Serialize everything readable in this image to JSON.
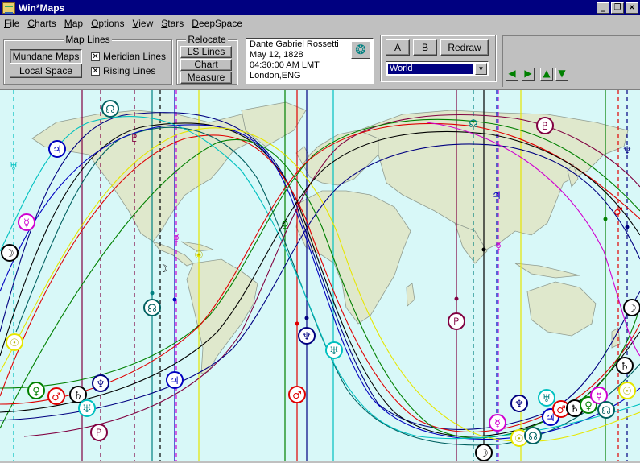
{
  "window": {
    "title": "Win*Maps",
    "min_label": "_",
    "restore_label": "❐",
    "close_label": "×"
  },
  "menu": [
    {
      "label": "File",
      "key": "F",
      "rest": "ile"
    },
    {
      "label": "Charts",
      "key": "C",
      "rest": "harts"
    },
    {
      "label": "Map",
      "key": "M",
      "rest": "ap"
    },
    {
      "label": "Options",
      "key": "O",
      "rest": "ptions"
    },
    {
      "label": "View",
      "key": "V",
      "rest": "iew"
    },
    {
      "label": "Stars",
      "key": "S",
      "rest": "tars"
    },
    {
      "label": "DeepSpace",
      "key": "D",
      "rest": "eepSpace"
    }
  ],
  "map_lines": {
    "title": "Map Lines",
    "mundane_label": "Mundane Maps",
    "local_label": "Local Space",
    "meridian_label": "Meridian Lines",
    "rising_label": "Rising Lines",
    "meridian_checked": "✕",
    "rising_checked": "✕"
  },
  "relocate": {
    "title": "Relocate",
    "ls_lines_label": "LS  Lines",
    "chart_label": "Chart",
    "measure_label": "Measure"
  },
  "chart_info": {
    "name": "Dante Gabriel Rossetti",
    "date": "May 12, 1828",
    "time": "04:30:00 AM LMT",
    "place": "London,ENG",
    "wheel_icon": "❂"
  },
  "chart_buttons": {
    "a_label": "A",
    "b_label": "B",
    "redraw_label": "Redraw"
  },
  "region_select": {
    "value": "World"
  },
  "nav": {
    "left": "◀",
    "right": "▶",
    "up": "▲",
    "down": "▼"
  },
  "colors": {
    "ocean": "#d8f8f8",
    "land": "#dfe8cc",
    "border": "#909c90",
    "sun": "#e6e600",
    "moon": "#000000",
    "mercury": "#d000d0",
    "venus": "#008000",
    "mars": "#e00000",
    "jupiter": "#0000c0",
    "saturn": "#000000",
    "uranus": "#00c0c0",
    "neptune": "#000080",
    "pluto": "#800040",
    "node": "#006060"
  },
  "planet_markers": [
    {
      "glyph": "☊",
      "color": "#006060"
    },
    {
      "glyph": "♃",
      "color": "#0000c0"
    },
    {
      "glyph": "☿",
      "color": "#d000d0"
    },
    {
      "glyph": "☽",
      "color": "#000000"
    },
    {
      "glyph": "☉",
      "color": "#e6e600"
    },
    {
      "glyph": "♀",
      "color": "#008000"
    },
    {
      "glyph": "♂",
      "color": "#e00000"
    },
    {
      "glyph": "♄",
      "color": "#000000"
    },
    {
      "glyph": "♅",
      "color": "#00c0c0"
    },
    {
      "glyph": "♆",
      "color": "#000080"
    },
    {
      "glyph": "♇",
      "color": "#800040"
    }
  ]
}
